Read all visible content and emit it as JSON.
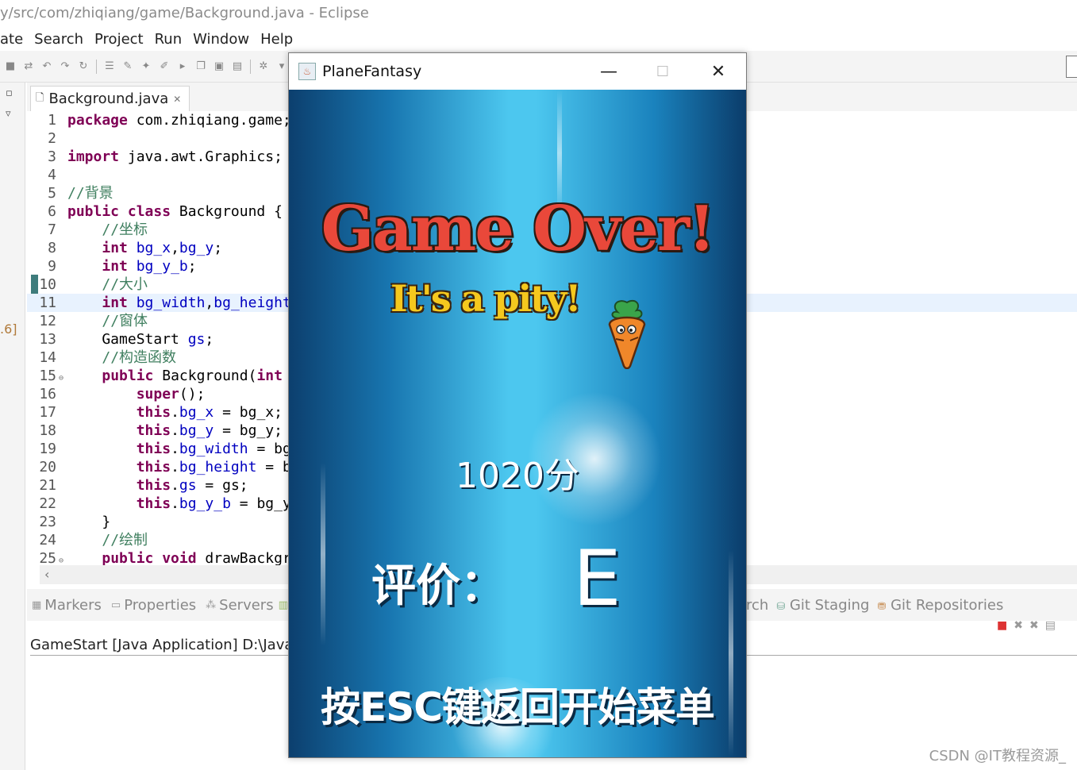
{
  "eclipse": {
    "title": "y/src/com/zhiqiang/game/Background.java - Eclipse",
    "menu": [
      "ate",
      "Search",
      "Project",
      "Run",
      "Window",
      "Help"
    ],
    "left_label": ".6]",
    "editor_tab": "Background.java",
    "editor_tab_close": "✕",
    "code": [
      {
        "n": "1",
        "html": "<span class=\"kw\">package</span> com.zhiqiang.game;"
      },
      {
        "n": "2",
        "html": ""
      },
      {
        "n": "3",
        "html": "<span class=\"kw\">import</span> java.awt.Graphics;"
      },
      {
        "n": "4",
        "html": ""
      },
      {
        "n": "5",
        "html": "<span class=\"cm\">//背景</span>"
      },
      {
        "n": "6",
        "html": "<span class=\"kw\">public class</span> Background {"
      },
      {
        "n": "7",
        "html": "    <span class=\"cm\">//坐标</span>"
      },
      {
        "n": "8",
        "html": "    <span class=\"kw\">int</span> <span class=\"fd\">bg_x</span>,<span class=\"fd\">bg_y</span>;"
      },
      {
        "n": "9",
        "html": "    <span class=\"kw\">int</span> <span class=\"fd\">bg_y_b</span>;"
      },
      {
        "n": "10",
        "html": "    <span class=\"cm\">//大小</span>"
      },
      {
        "n": "11",
        "html": "    <span class=\"kw\">int</span> <span class=\"fd\">bg_width</span>,<span class=\"fd\">bg_height</span>;"
      },
      {
        "n": "12",
        "html": "    <span class=\"cm\">//窗体</span>"
      },
      {
        "n": "13",
        "html": "    GameStart <span class=\"fd\">gs</span>;"
      },
      {
        "n": "14",
        "html": "    <span class=\"cm\">//构造函数</span>"
      },
      {
        "n": "15",
        "html": "    <span class=\"kw\">public</span> Background(<span class=\"kw\">int</span>                                          rt gs) {"
      },
      {
        "n": "16",
        "html": "        <span class=\"kw\">super</span>();"
      },
      {
        "n": "17",
        "html": "        <span class=\"kw\">this</span>.<span class=\"fd\">bg_x</span> = bg_x;"
      },
      {
        "n": "18",
        "html": "        <span class=\"kw\">this</span>.<span class=\"fd\">bg_y</span> = bg_y;"
      },
      {
        "n": "19",
        "html": "        <span class=\"kw\">this</span>.<span class=\"fd\">bg_width</span> = bg_width;"
      },
      {
        "n": "20",
        "html": "        <span class=\"kw\">this</span>.<span class=\"fd\">bg_height</span> = bg_height;"
      },
      {
        "n": "21",
        "html": "        <span class=\"kw\">this</span>.<span class=\"fd\">gs</span> = gs;"
      },
      {
        "n": "22",
        "html": "        <span class=\"kw\">this</span>.<span class=\"fd\">bg_y_b</span> = bg_y;"
      },
      {
        "n": "23",
        "html": "    }"
      },
      {
        "n": "24",
        "html": "    <span class=\"cm\">//绘制</span>"
      },
      {
        "n": "25",
        "html": "    <span class=\"kw\">public void</span> drawBackground(Graphics g) {"
      }
    ],
    "fold_lines": [
      "15",
      "25"
    ],
    "bottom_tabs": [
      "Markers",
      "Properties",
      "Servers"
    ],
    "right_tabs": [
      "rch",
      "Git Staging",
      "Git Repositories"
    ],
    "console_header": "GameStart [Java Application] D:\\Java\\j",
    "watermark": "CSDN @IT教程资源_"
  },
  "game_window": {
    "title": "PlaneFantasy",
    "heading": "Game Over!",
    "subheading": "It's a pity!",
    "score": "1020分",
    "rating_label": "评价：",
    "rating_value": "E",
    "hint": "按ESC键返回开始菜单"
  },
  "colors": {
    "keyword": "#7f0055",
    "comment": "#3f7f5f",
    "field": "#0000c0",
    "game_bg_center": "#4cc7ef",
    "game_bg_edge": "#0c3f6e",
    "game_over_red": "#e9483a",
    "pity_yellow": "#f5c81e"
  }
}
